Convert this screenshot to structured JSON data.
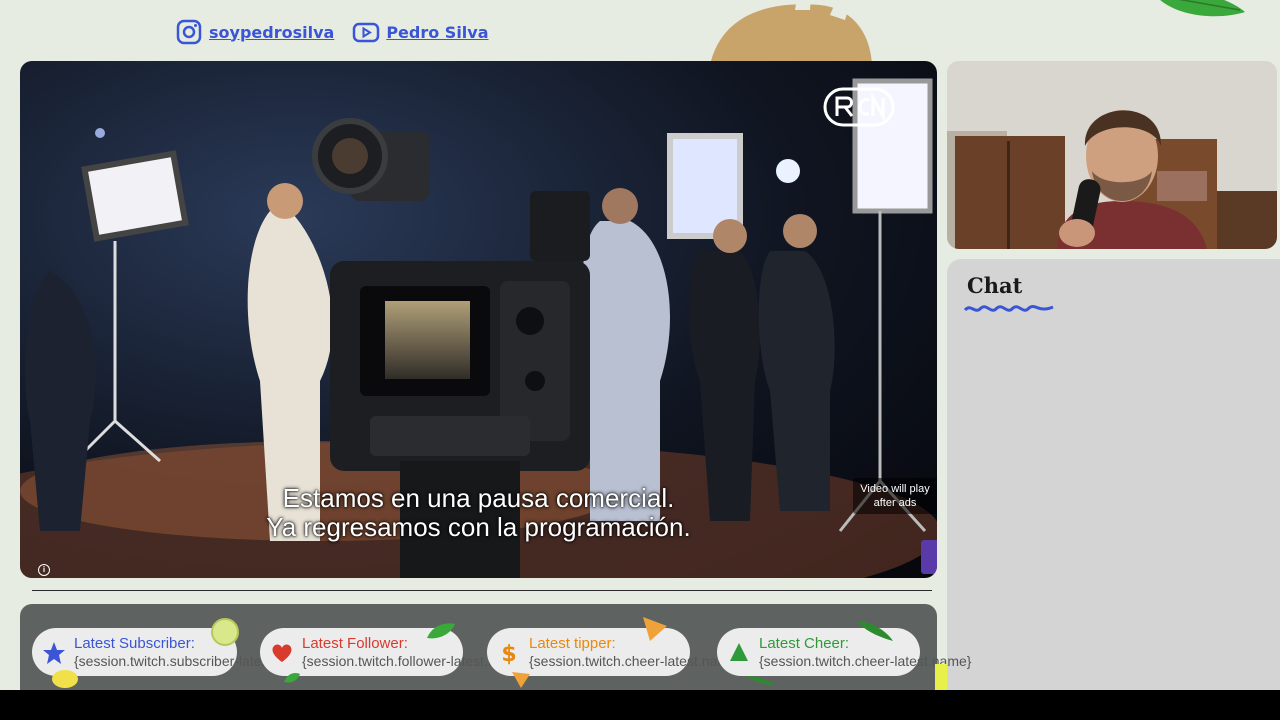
{
  "social": {
    "instagram": {
      "icon": "instagram-icon",
      "handle": "soypedrosilva"
    },
    "youtube": {
      "icon": "youtube-icon",
      "handle": "Pedro Silva"
    }
  },
  "video": {
    "subtitle_line1": "Estamos en una pausa comercial.",
    "subtitle_line2": "Ya regresamos con la programación.",
    "ad_note": "Video will play after ads",
    "logo": "RCN"
  },
  "chat": {
    "title": "Chat"
  },
  "stats": [
    {
      "icon": "star-icon",
      "label": "Latest Subscriber:",
      "value": "{session.twitch.subscriber-latest.name}",
      "color": "#3a55d6"
    },
    {
      "icon": "heart-icon",
      "label": "Latest Follower:",
      "value": "{session.twitch.follower-latest.name}",
      "color": "#d83a2e"
    },
    {
      "icon": "dollar-icon",
      "label": "Latest tipper:",
      "value": "{session.twitch.cheer-latest.name}",
      "color": "#e8880e"
    },
    {
      "icon": "tree-icon",
      "label": "Latest Cheer:",
      "value": "{session.twitch.cheer-latest.name}",
      "color": "#2e9a3a"
    }
  ],
  "colors": {
    "background": "#e6ece2",
    "link": "#3a55d6",
    "chat_panel": "#d4d4d4",
    "bar": "#5e6361"
  }
}
